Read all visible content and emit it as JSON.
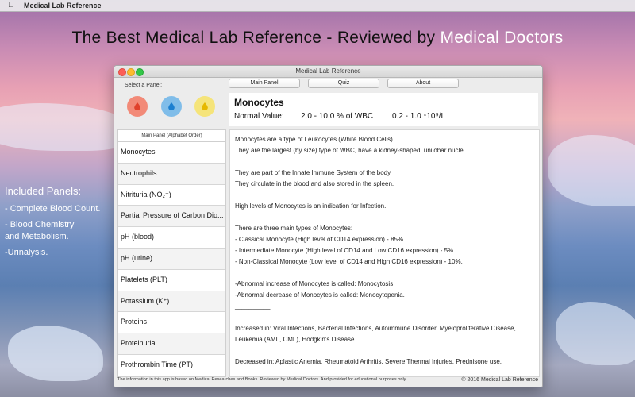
{
  "menubar": {
    "apple_icon": "apple-icon",
    "app_name": "Medical Lab Reference"
  },
  "hero": {
    "title_plain": "The Best Medical Lab Reference - Reviewed by",
    "title_accent": "Medical Doctors"
  },
  "side_info": {
    "heading": "Included Panels:",
    "items": [
      "- Complete Blood Count.",
      "- Blood Chemistry\n  and Metabolism.",
      "-Urinalysis."
    ]
  },
  "window": {
    "title": "Medical Lab Reference",
    "select_label": "Select a Panel:",
    "panel_icons": [
      "drop-icon",
      "drop-icon",
      "drop-icon"
    ],
    "colors": {
      "red_panel": "#f28a78",
      "blue_panel": "#80bde9",
      "yellow_panel": "#f5e47a"
    },
    "buttons": {
      "main": "Main Panel",
      "quiz": "Quiz",
      "about": "About"
    },
    "header": {
      "title": "Monocytes",
      "normal_value_label": "Normal Value:",
      "normal_value_percent": "2.0 - 10.0 % of WBC",
      "normal_value_abs": "0.2 - 1.0 *10⁹/L"
    },
    "list": {
      "header": "Main Panel (Alphabet Order)",
      "items": [
        "Monocytes",
        "Neutrophils",
        "Nitrituria (NO₂⁻)",
        "Partial Pressure of Carbon Dio...",
        "pH (blood)",
        "pH (urine)",
        "Platelets (PLT)",
        "Potassium (K⁺)",
        "Proteins",
        "Proteinuria",
        "Prothrombin Time (PT)"
      ]
    },
    "content": "Monocytes are a type of Leukocytes (White Blood Cells).\nThey are the largest (by size) type of WBC, have a kidney-shaped, unilobar nuclei.\n\nThey are part of the Innate Immune System of the body.\nThey circulate in the blood and also stored in the spleen.\n\nHigh levels of Monocytes is an indication for Infection.\n\nThere are three main types of Monocytes:\n- Classical Monocyte (High level of CD14 expression) - 85%.\n- Intermediate Monocyte (High level of CD14 and Low CD16 expression) - 5%.\n- Non-Classical Monocyte (Low level of CD14 and High CD16 expression) - 10%.\n\n-Abnormal increase of Monocytes is called: Monocytosis.\n-Abnormal decrease of Monocytes is called: Monocytopenia.\n__________\n\nIncreased in: Viral Infections, Bacterial Infections, Autoimmune Disorder, Myeloproliferative Disease,\nLeukemia (AML, CML), Hodgkin's Disease.\n\nDecreased in: Aplastic Anemia, Rheumatoid Arthritis, Severe Thermal Injuries, Prednisone use.",
    "footer": {
      "note": "The information in this app is based on Medical Researches and Books. Reviewed by Medical Doctors. And provided for educational purposes only.",
      "copyright": "© 2016 Medical Lab Reference"
    }
  }
}
